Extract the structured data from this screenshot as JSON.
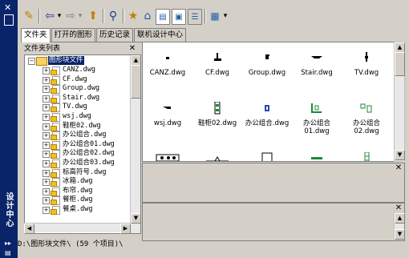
{
  "sidebar_title": "设计中心",
  "tabs": [
    {
      "label": "文件夹",
      "active": true
    },
    {
      "label": "打开的图形",
      "active": false
    },
    {
      "label": "历史记录",
      "active": false
    },
    {
      "label": "联机设计中心",
      "active": false
    }
  ],
  "tree": {
    "title": "文件夹列表",
    "root": "图形块文件",
    "items": [
      "CANZ.dwg",
      "CF.dwg",
      "Group.dwg",
      "Stair.dwg",
      "TV.dwg",
      "wsj.dwg",
      "鞋柜02.dwg",
      "办公组合.dwg",
      "办公组合01.dwg",
      "办公组合02.dwg",
      "办公组合03.dwg",
      "标高符号.dwg",
      "冰箱.dwg",
      "布帘.dwg",
      "餐柜.dwg",
      "餐桌.dwg"
    ]
  },
  "grid": {
    "items": [
      {
        "label": "CANZ.dwg",
        "icon": "canz-icon"
      },
      {
        "label": "CF.dwg",
        "icon": "cf-icon"
      },
      {
        "label": "Group.dwg",
        "icon": "group-icon"
      },
      {
        "label": "Stair.dwg",
        "icon": "stair-icon"
      },
      {
        "label": "TV.dwg",
        "icon": "tv-icon"
      },
      {
        "label": "wsj.dwg",
        "icon": "wsj-icon"
      },
      {
        "label": "鞋柜02.dwg",
        "icon": "shoe-cabinet-icon"
      },
      {
        "label": "办公组合.dwg",
        "icon": "office-icon"
      },
      {
        "label": "办公组合01.dwg",
        "icon": "office01-icon"
      },
      {
        "label": "办公组合02.dwg",
        "icon": "office02-icon"
      },
      {
        "label": "",
        "icon": "office03-icon"
      },
      {
        "label": "",
        "icon": "elevation-icon"
      },
      {
        "label": "",
        "icon": "fridge-icon"
      },
      {
        "label": "",
        "icon": "curtain-icon"
      },
      {
        "label": "",
        "icon": "cabinet-icon"
      }
    ]
  },
  "status": "D:\\图形块文件\\ (59 个项目)\\",
  "colors": {
    "titlebar": "#0a246a",
    "panel": "#d4d0c8",
    "selection": "#0a246a"
  }
}
